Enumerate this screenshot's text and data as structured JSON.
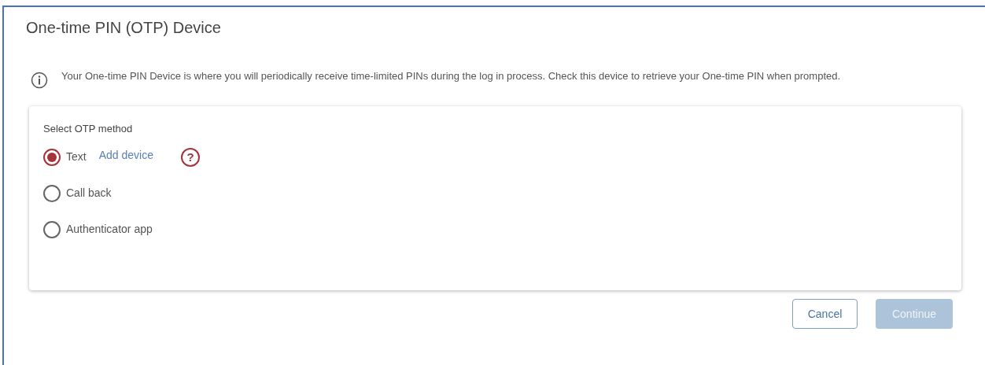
{
  "title": "One-time PIN (OTP) Device",
  "info": "Your One-time PIN Device is where you will periodically receive time-limited PINs during the log in process. Check this device to retrieve your One-time PIN when prompted.",
  "method_group": {
    "label": "Select OTP method",
    "options": [
      {
        "label": "Text",
        "selected": true,
        "link": "Add device",
        "help": "?"
      },
      {
        "label": "Call back",
        "selected": false
      },
      {
        "label": "Authenticator app",
        "selected": false
      }
    ]
  },
  "buttons": [
    {
      "label": "Cancel",
      "kind": "secondary",
      "disabled": false
    },
    {
      "label": "Continue",
      "kind": "primary",
      "disabled": true
    }
  ]
}
